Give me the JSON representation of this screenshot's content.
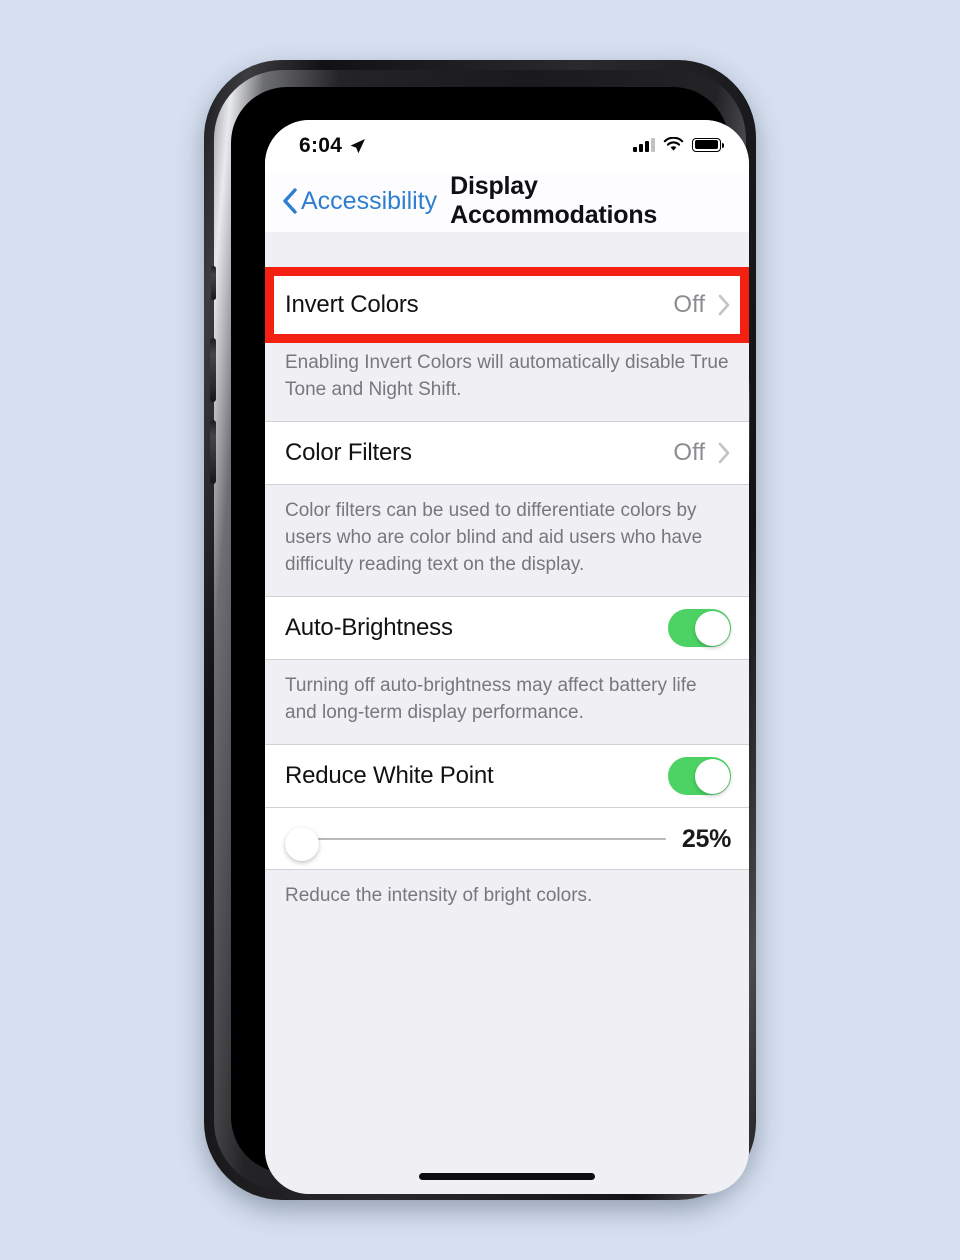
{
  "page": {
    "background_color": "#d6e0f0",
    "device": "iPhone X"
  },
  "status_bar": {
    "time": "6:04",
    "location_icon": "location-arrow-icon",
    "signal_icon": "cellular-signal-icon",
    "signal_bars_filled": 3,
    "signal_bars_total": 4,
    "wifi_icon": "wifi-icon",
    "battery_icon": "battery-full-icon",
    "battery_level_percent": 100
  },
  "nav_bar": {
    "back_icon": "chevron-left-icon",
    "back_label": "Accessibility",
    "title": "Display Accommodations",
    "back_color": "#2f7fd0"
  },
  "highlight": {
    "color": "#f42113",
    "target": "invert-colors-row"
  },
  "sections": [
    {
      "name": "invert-colors",
      "row": {
        "title": "Invert Colors",
        "value": "Off",
        "accessory_icon": "chevron-right-icon",
        "type": "disclosure"
      },
      "footnote": "Enabling Invert Colors will automatically disable True Tone and Night Shift."
    },
    {
      "name": "color-filters",
      "row": {
        "title": "Color Filters",
        "value": "Off",
        "accessory_icon": "chevron-right-icon",
        "type": "disclosure"
      },
      "footnote": "Color filters can be used to differentiate colors by users who are color blind and aid users who have difficulty reading text on the display."
    },
    {
      "name": "auto-brightness",
      "row": {
        "title": "Auto-Brightness",
        "type": "toggle",
        "toggle_on": true,
        "toggle_on_color": "#4cd364"
      },
      "footnote": "Turning off auto-brightness may affect battery life and long-term display performance."
    },
    {
      "name": "reduce-white-point",
      "row": {
        "title": "Reduce White Point",
        "type": "toggle",
        "toggle_on": true,
        "toggle_on_color": "#4cd364"
      },
      "slider": {
        "value_label": "25%",
        "value": 25,
        "min": 0,
        "max": 100,
        "knob_position_percent": 0
      },
      "footnote": "Reduce the intensity of bright colors."
    }
  ],
  "home_indicator": "home-indicator"
}
